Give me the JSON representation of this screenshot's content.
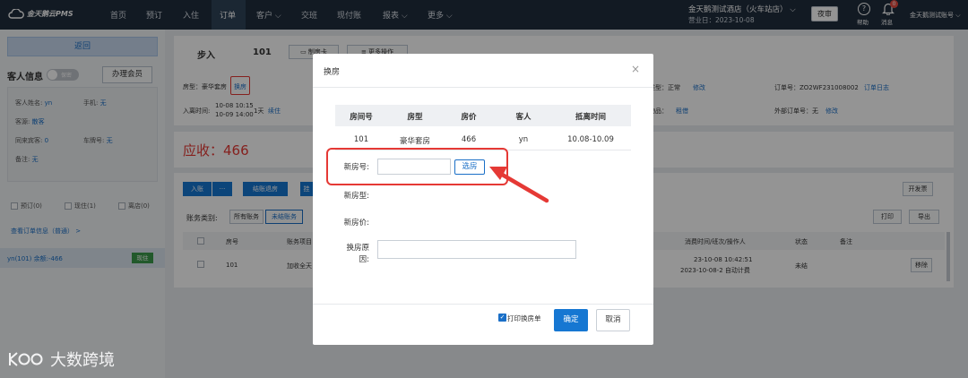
{
  "app": {
    "logo_text": "金天鹅云PMS"
  },
  "nav": {
    "items": [
      "首页",
      "预订",
      "入住",
      "订单",
      "客户",
      "交班",
      "现付账",
      "报表",
      "更多"
    ],
    "active_index": 3,
    "hotel_name": "金天鹅测试酒店（火车站店）",
    "biz_day": "营业日：2023-10-08",
    "night_audit": "夜审",
    "help": "帮助",
    "messages": "消息",
    "msg_count": "0",
    "account": "金天鹅测试账号"
  },
  "sidebar": {
    "back": "返回",
    "guest_info_title": "客人信息",
    "toggle_text": "保密",
    "member_btn": "办理会员",
    "rows": [
      {
        "label": "客人姓名:",
        "value": "yn"
      },
      {
        "label": "手机:",
        "value": "无"
      },
      {
        "label": "客源:",
        "value": "散客"
      },
      {
        "label": "同来宾客:",
        "value": "0"
      },
      {
        "label": "车牌号:",
        "value": "无"
      },
      {
        "label": "备注:",
        "value": "无"
      }
    ],
    "checkboxes": [
      "预订(0)",
      "现住(1)",
      "离店(0)"
    ],
    "order_link": "查看订单信息（普通） >",
    "room_row": "yn(101)  余额:-466",
    "room_status": "现住"
  },
  "order": {
    "step": "步入",
    "room_no": "101",
    "room_card": "制房卡",
    "more_ops": "更多操作",
    "room_type_label": "房型：豪华套房",
    "change_room_link": "换房",
    "checkin_label": "入离时间:",
    "checkin_time": "10-08 10:15",
    "checkout_time": "10-09 14:00",
    "nights": "1天",
    "renew": "续住",
    "order_type": "类型：正常",
    "modify": "修改",
    "order_no": "订单号：ZO2WF231008002",
    "order_log": "订单日志",
    "goods": "物品：",
    "lend": "租借",
    "ext_order": "外部订单号：无",
    "ext_modify": "修改",
    "receivable": "应收：466"
  },
  "bill": {
    "checkin_btn": "入账",
    "dots": "···",
    "settle_btn": "结账退房",
    "ops_partial": "挂",
    "invoice": "开发票",
    "print": "打印",
    "export": "导出",
    "category_label": "账务类别:",
    "filters": [
      "所有账务",
      "未结账务"
    ],
    "columns": [
      "房号",
      "账务项目",
      "消费时间/班次/操作人",
      "状态",
      "备注"
    ],
    "row": {
      "room": "101",
      "item": "加收全天",
      "time1": "23-10-08 10:42:51",
      "time2": "2023-10-08-2 自动计费",
      "status": "未结",
      "op": "移除"
    }
  },
  "modal": {
    "title": "换房",
    "close": "×",
    "table": {
      "headers": [
        "房间号",
        "房型",
        "房价",
        "客人",
        "抵离时间"
      ],
      "row": [
        "101",
        "豪华套房",
        "466",
        "yn",
        "10.08-10.09"
      ]
    },
    "new_room_label": "新房号:",
    "pick_room": "选房",
    "new_type_label": "新房型:",
    "new_price_label": "新房价:",
    "reason_label_line1": "换房原",
    "reason_label_line2": "因:",
    "print_label": "打印换房单",
    "ok": "确定",
    "cancel": "取消"
  },
  "watermark": {
    "text": "大数跨境"
  },
  "colors": {
    "nav_bg": "#1f2d3d",
    "primary": "#1677d2",
    "highlight_red": "#e53935",
    "receivable_red": "#e53935"
  }
}
